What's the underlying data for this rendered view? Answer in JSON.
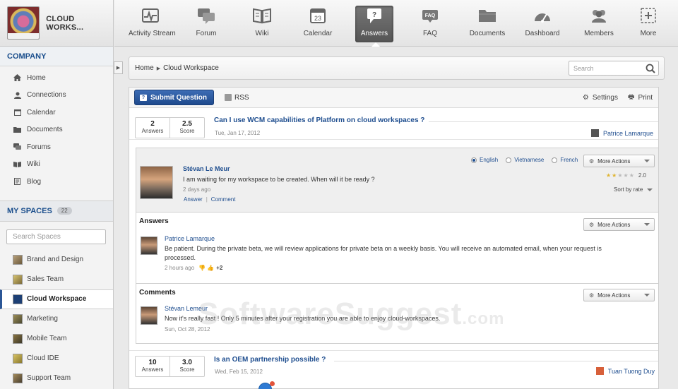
{
  "brand": {
    "name": "CLOUD WORKS..."
  },
  "toolbar": {
    "items": [
      {
        "label": "Activity Stream",
        "icon": "activity-stream-icon"
      },
      {
        "label": "Forum",
        "icon": "forum-icon"
      },
      {
        "label": "Wiki",
        "icon": "wiki-icon"
      },
      {
        "label": "Calendar",
        "icon": "calendar-icon",
        "day": "23"
      },
      {
        "label": "Answers",
        "icon": "answers-icon",
        "active": true
      },
      {
        "label": "FAQ",
        "icon": "faq-icon",
        "badge": "FAQ"
      },
      {
        "label": "Documents",
        "icon": "documents-icon"
      },
      {
        "label": "Dashboard",
        "icon": "dashboard-icon"
      },
      {
        "label": "Members",
        "icon": "members-icon"
      },
      {
        "label": "More",
        "icon": "more-icon"
      }
    ]
  },
  "sidebar": {
    "company_title": "COMPANY",
    "company_items": [
      {
        "label": "Home",
        "icon": "home-icon"
      },
      {
        "label": "Connections",
        "icon": "connections-icon"
      },
      {
        "label": "Calendar",
        "icon": "calendar-icon"
      },
      {
        "label": "Documents",
        "icon": "documents-icon"
      },
      {
        "label": "Forums",
        "icon": "forums-icon"
      },
      {
        "label": "Wiki",
        "icon": "wiki-icon"
      },
      {
        "label": "Blog",
        "icon": "blog-icon"
      }
    ],
    "spaces_title": "MY SPACES",
    "spaces_count": "22",
    "search_placeholder": "Search Spaces",
    "spaces": [
      {
        "label": "Brand and Design"
      },
      {
        "label": "Sales Team"
      },
      {
        "label": "Cloud Workspace",
        "active": true
      },
      {
        "label": "Marketing"
      },
      {
        "label": "Mobile Team"
      },
      {
        "label": "Cloud IDE"
      },
      {
        "label": "Support Team"
      }
    ]
  },
  "breadcrumb": {
    "home": "Home",
    "current": "Cloud Workspace"
  },
  "search": {
    "placeholder": "Search"
  },
  "actions": {
    "submit": "Submit Question",
    "rss": "RSS",
    "settings": "Settings",
    "print": "Print"
  },
  "questions": [
    {
      "answers_count": "2",
      "answers_label": "Answers",
      "score": "2.5",
      "score_label": "Score",
      "title": "Can I use WCM capabilities of Platform on cloud workspaces ?",
      "date": "Tue, Jan 17, 2012",
      "author": "Patrice Lamarque"
    },
    {
      "answers_count": "10",
      "answers_label": "Answers",
      "score": "3.0",
      "score_label": "Score",
      "title": "Is an OEM partnership possible ?",
      "date": "Wed, Feb 15, 2012",
      "author": "Tuan Tuong Duy"
    }
  ],
  "detail": {
    "asker": "Stévan Le Meur",
    "text": "I am waiting for my workspace to be created. When will it be ready ?",
    "ago": "2 days ago",
    "answer_link": "Answer",
    "comment_link": "Comment",
    "languages": [
      {
        "label": "English",
        "selected": true
      },
      {
        "label": "Vietnamese",
        "selected": false
      },
      {
        "label": "French",
        "selected": false
      }
    ],
    "more_actions": "More Actions",
    "rating": "2.0",
    "rating_stars": 2,
    "rating_max": 5,
    "sort_by": "Sort by rate",
    "answers_title": "Answers",
    "answer": {
      "user": "Patrice Lamarque",
      "text": "Be patient. During the private beta, we will review applications for private beta on a weekly basis. You will receive an automated email, when your request is processed.",
      "ago": "2 hours ago",
      "votes": "+2"
    },
    "comments_title": "Comments",
    "comment": {
      "user": "Stévan Lemeur",
      "text": "Now it's really fast ! Only 5 minutes after your registration you are able to enjoy cloud-workspaces.",
      "date": "Sun, Oct 28, 2012"
    }
  },
  "watermark": {
    "main": "SoftwareSuggest",
    "suffix": ".com"
  },
  "colors": {
    "brand_blue": "#1f4e8f",
    "button_blue": "#2b5a9e",
    "active_tool": "#5a5a5a"
  }
}
